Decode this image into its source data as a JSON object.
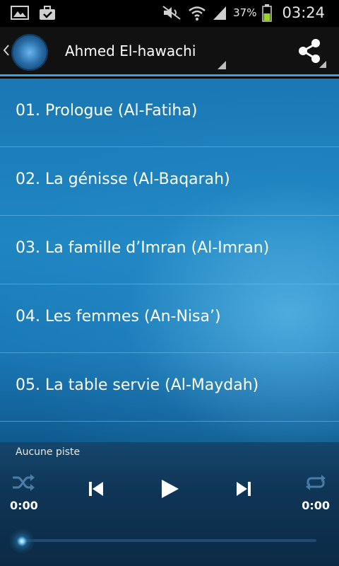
{
  "status_bar": {
    "battery_percent": "37%",
    "time": "03:24"
  },
  "action_bar": {
    "title": "Ahmed El-hawachi"
  },
  "tracks": [
    {
      "label": "01. Prologue (Al-Fatiha)"
    },
    {
      "label": "02. La génisse (Al-Baqarah)"
    },
    {
      "label": "03. La famille d’Imran (Al-Imran)"
    },
    {
      "label": "04. Les femmes (An-Nisa’)"
    },
    {
      "label": "05. La table servie (Al-Maydah)"
    }
  ],
  "player": {
    "track_name": "Aucune piste",
    "elapsed": "0:00",
    "duration": "0:00",
    "progress": 0
  },
  "colors": {
    "accent": "#2fa6e6",
    "list_bg": "#1a78b4",
    "player_bg": "#0f3556"
  }
}
